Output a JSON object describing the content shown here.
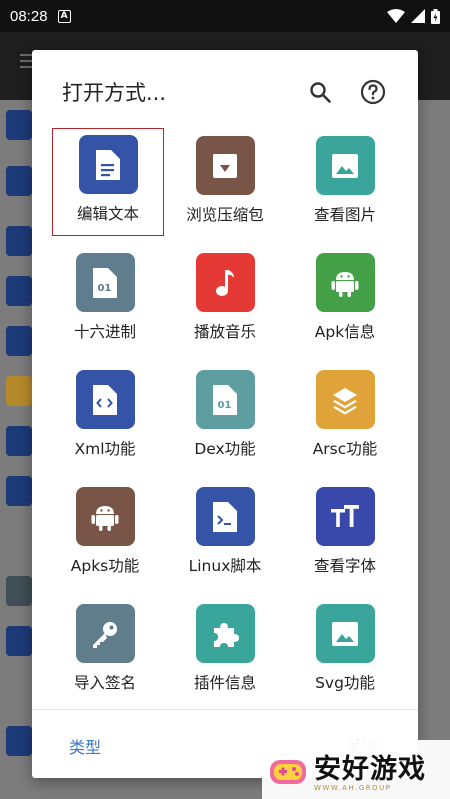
{
  "status_bar": {
    "time": "08:28",
    "notification_badge": "A"
  },
  "dialog": {
    "title": "打开方式...",
    "tiles": [
      {
        "label": "编辑文本",
        "icon": "document-icon",
        "color": "#3554a8"
      },
      {
        "label": "浏览压缩包",
        "icon": "archive-icon",
        "color": "#795548"
      },
      {
        "label": "查看图片",
        "icon": "image-icon",
        "color": "#3aa59b"
      },
      {
        "label": "十六进制",
        "icon": "binary-file-icon",
        "color": "#5f7d8c"
      },
      {
        "label": "播放音乐",
        "icon": "music-note-icon",
        "color": "#e53935"
      },
      {
        "label": "Apk信息",
        "icon": "android-icon",
        "color": "#43a047"
      },
      {
        "label": "Xml功能",
        "icon": "code-file-icon",
        "color": "#3554a8"
      },
      {
        "label": "Dex功能",
        "icon": "binary-file-icon",
        "color": "#5f9ea0"
      },
      {
        "label": "Arsc功能",
        "icon": "layers-icon",
        "color": "#e0a33a"
      },
      {
        "label": "Apks功能",
        "icon": "android-icon",
        "color": "#795548"
      },
      {
        "label": "Linux脚本",
        "icon": "terminal-file-icon",
        "color": "#3554a8"
      },
      {
        "label": "查看字体",
        "icon": "font-icon",
        "color": "#3949ab"
      },
      {
        "label": "导入签名",
        "icon": "key-icon",
        "color": "#607d8b"
      },
      {
        "label": "插件信息",
        "icon": "puzzle-icon",
        "color": "#3aa59b"
      },
      {
        "label": "Svg功能",
        "icon": "image-icon",
        "color": "#3aa59b"
      }
    ],
    "footer": {
      "type_label": "类型",
      "close_label": "关闭"
    }
  },
  "watermark": {
    "main": "安好游戏",
    "sub": "WWW.AH.GROUP"
  }
}
